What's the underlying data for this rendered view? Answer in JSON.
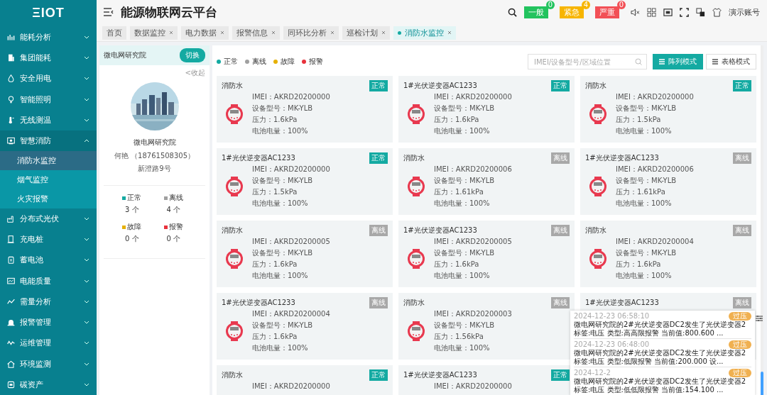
{
  "logo": "ΞIOT",
  "sidebar": {
    "items": [
      {
        "label": "能耗分析",
        "expanded": false
      },
      {
        "label": "集团能耗",
        "expanded": false
      },
      {
        "label": "安全用电",
        "expanded": false
      },
      {
        "label": "智能照明",
        "expanded": false
      },
      {
        "label": "无线测温",
        "expanded": false
      },
      {
        "label": "智慧消防",
        "expanded": true,
        "children": [
          {
            "label": "消防水监控",
            "selected": true
          },
          {
            "label": "烟气监控",
            "selected": false
          },
          {
            "label": "火灾报警",
            "selected": false
          }
        ]
      },
      {
        "label": "分布式光伏",
        "expanded": false
      },
      {
        "label": "充电桩",
        "expanded": false
      },
      {
        "label": "蓄电池",
        "expanded": false
      },
      {
        "label": "电能质量",
        "expanded": false
      },
      {
        "label": "需量分析",
        "expanded": false
      },
      {
        "label": "报警管理",
        "expanded": false
      },
      {
        "label": "运维管理",
        "expanded": false
      },
      {
        "label": "环境监测",
        "expanded": false
      },
      {
        "label": "碳资产",
        "expanded": false
      }
    ]
  },
  "header": {
    "title": "能源物联网云平台",
    "alerts": [
      {
        "label": "一般",
        "count": "0",
        "color": "#22c35e"
      },
      {
        "label": "紧急",
        "count": "4",
        "color": "#f7b500"
      },
      {
        "label": "严重",
        "count": "0",
        "color": "#f25056"
      }
    ],
    "user": "演示账号"
  },
  "tabs": [
    {
      "label": "首页",
      "selected": false,
      "closable": false
    },
    {
      "label": "数据监控",
      "selected": false,
      "closable": true
    },
    {
      "label": "电力数据",
      "selected": false,
      "closable": true
    },
    {
      "label": "报警信息",
      "selected": false,
      "closable": true
    },
    {
      "label": "同环比分析",
      "selected": false,
      "closable": true
    },
    {
      "label": "巡检计划",
      "selected": false,
      "closable": true
    },
    {
      "label": "消防水监控",
      "selected": true,
      "closable": true
    }
  ],
  "site_panel": {
    "site": "微电网研究院",
    "switch_button": "切换",
    "collapse_link": "<收起",
    "name": "微电网研究院",
    "contact": "何艳 （18761508305）",
    "address": "新澄路9号",
    "stats": [
      {
        "label": "正常",
        "value": "3",
        "unit": "个",
        "color": "#14aaa2"
      },
      {
        "label": "离线",
        "value": "4",
        "unit": "个",
        "color": "#a0a0a0"
      },
      {
        "label": "故障",
        "value": "0",
        "unit": "个",
        "color": "#e6b000"
      },
      {
        "label": "报警",
        "value": "0",
        "unit": "个",
        "color": "#e8323c"
      }
    ]
  },
  "legend": [
    {
      "label": "正常",
      "color": "#14aaa2"
    },
    {
      "label": "离线",
      "color": "#a0a0a0"
    },
    {
      "label": "故障",
      "color": "#e6b000"
    },
    {
      "label": "报警",
      "color": "#e8323c"
    }
  ],
  "search": {
    "placeholder": "IMEI/设备型号/区域位置"
  },
  "view_buttons": [
    {
      "label": "阵列模式",
      "selected": true
    },
    {
      "label": "表格模式",
      "selected": false
    }
  ],
  "devices": [
    {
      "title": "消防水",
      "kind": "normal",
      "badge": "正常",
      "lines": [
        "IMEI：AKRD20200000",
        "设备型号：MK-YLB",
        "压力：1.6kPa",
        "电池电量：100%"
      ]
    },
    {
      "title": "1#光伏逆变器AC1233",
      "kind": "normal",
      "badge": "正常",
      "lines": [
        "IMEI：AKRD20200000",
        "设备型号：MK-YLB",
        "压力：1.6kPa",
        "电池电量：100%"
      ]
    },
    {
      "title": "消防水",
      "kind": "normal",
      "badge": "正常",
      "lines": [
        "IMEI：AKRD20200000",
        "设备型号：MK-YLB",
        "压力：1.5kPa",
        "电池电量：100%"
      ]
    },
    {
      "title": "1#光伏逆变器AC1233",
      "kind": "normal",
      "badge": "正常",
      "lines": [
        "IMEI：AKRD20200000",
        "设备型号：MK-YLB",
        "压力：1.5kPa",
        "电池电量：100%"
      ]
    },
    {
      "title": "消防水",
      "kind": "offline",
      "badge": "离线",
      "lines": [
        "IMEI：AKRD20200006",
        "设备型号：MK-YLB",
        "压力：1.61kPa",
        "电池电量：100%"
      ]
    },
    {
      "title": "1#光伏逆变器AC1233",
      "kind": "offline",
      "badge": "离线",
      "lines": [
        "IMEI：AKRD20200006",
        "设备型号：MK-YLB",
        "压力：1.61kPa",
        "电池电量：100%"
      ]
    },
    {
      "title": "消防水",
      "kind": "offline",
      "badge": "离线",
      "lines": [
        "IMEI：AKRD20200005",
        "设备型号：MK-YLB",
        "压力：1.6kPa",
        "电池电量：100%"
      ]
    },
    {
      "title": "1#光伏逆变器AC1233",
      "kind": "offline",
      "badge": "离线",
      "lines": [
        "IMEI：AKRD20200005",
        "设备型号：MK-YLB",
        "压力：1.6kPa",
        "电池电量：100%"
      ]
    },
    {
      "title": "消防水",
      "kind": "offline",
      "badge": "离线",
      "lines": [
        "IMEI：AKRD20200004",
        "设备型号：MK-YLB",
        "压力：1.6kPa",
        "电池电量：100%"
      ]
    },
    {
      "title": "1#光伏逆变器AC1233",
      "kind": "offline",
      "badge": "离线",
      "lines": [
        "IMEI：AKRD20200004",
        "设备型号：MK-YLB",
        "压力：1.6kPa",
        "电池电量：100%"
      ]
    },
    {
      "title": "消防水",
      "kind": "offline",
      "badge": "离线",
      "lines": [
        "IMEI：AKRD20200003",
        "设备型号：MK-YLB",
        "压力：1.56kPa",
        "电池电量：100%"
      ]
    },
    {
      "title": "1#光伏逆变器AC1233",
      "kind": "offline",
      "badge": "离线"
    },
    {
      "title": "消防水",
      "kind": "normal",
      "badge": "正常",
      "lines": [
        "IMEI：AKRD20200000"
      ]
    },
    {
      "title": "1#光伏逆变器AC1233",
      "kind": "normal",
      "badge": "正常",
      "lines": [
        "IMEI：AKRD20200000"
      ]
    }
  ],
  "notifications": [
    {
      "time": "2024-12-23 06:58:10",
      "tag": "过压",
      "message": "微电网研究院的2#光伏逆变器DC2发生了光伏逆变器2 标签:电压 类型:高高限报警 当前值:800.600 ..."
    },
    {
      "time": "2024-12-23 06:48:00",
      "tag": "过压",
      "message": "微电网研究院的2#光伏逆变器DC2发生了光伏逆变器2 标签:电压 类型:低限报警 当前值:200.000 设..."
    },
    {
      "time": "2024-12-2",
      "tag": "过压",
      "message": "微电网研究院的2#光伏逆变器DC2发生了光伏逆变器2 标签:电压 类型:低低限报警 当前值:154.100 ..."
    }
  ]
}
